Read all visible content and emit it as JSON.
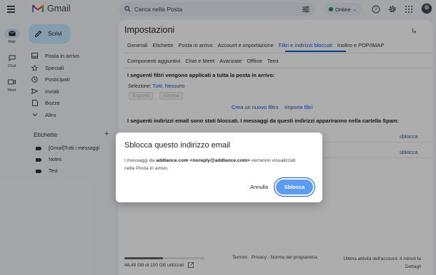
{
  "app": {
    "name": "Gmail"
  },
  "search": {
    "placeholder": "Cerca nella Posta"
  },
  "status": {
    "label": "Online",
    "color": "#1e8e3e"
  },
  "rail": [
    {
      "label": "Mail",
      "icon": "mail-icon",
      "active": true
    },
    {
      "label": "Chat",
      "icon": "chat-icon",
      "active": false
    },
    {
      "label": "Meet",
      "icon": "meet-icon",
      "active": false
    }
  ],
  "sidebar": {
    "compose": "Scrivi",
    "items": [
      {
        "label": "Posta in arrivo",
        "icon": "inbox-icon"
      },
      {
        "label": "Speciali",
        "icon": "star-icon"
      },
      {
        "label": "Posticipati",
        "icon": "clock-icon"
      },
      {
        "label": "Inviati",
        "icon": "send-icon"
      },
      {
        "label": "Bozze",
        "icon": "draft-icon"
      },
      {
        "label": "Altro",
        "icon": "chevron-down-icon"
      }
    ],
    "labels_title": "Etichette",
    "labels": [
      {
        "label": "[Gmail]Tutti i messaggi"
      },
      {
        "label": "Notes"
      },
      {
        "label": "Test"
      }
    ]
  },
  "main": {
    "title": "Impostazioni",
    "input_tools": "Iₐ",
    "tabs_row1": [
      "Generali",
      "Etichette",
      "Posta in arrivo",
      "Account e importazione",
      "Filtri e indirizzi bloccati",
      "Inoltro e POP/IMAP"
    ],
    "tabs_row2": [
      "Componenti aggiuntivi",
      "Chat e Meet",
      "Avanzate",
      "Offline",
      "Temi"
    ],
    "active_tab": "Filtri e indirizzi bloccati",
    "filters_heading": "I seguenti filtri vengono applicati a tutta la posta in arrivo:",
    "select_label": "Selezione:",
    "select_all": "Tutti",
    "select_none": "Nessuno",
    "export_label": "Esporta",
    "delete_label": "Elimina",
    "create_filter": "Crea un nuovo filtro",
    "import_filters": "Importa filtri",
    "blocked_heading": "I seguenti indirizzi email sono stati bloccati. I messaggi da questi indirizzi appariranno nella cartella Spam:",
    "unblock_links": [
      "sblocca",
      "sblocca"
    ],
    "storage_text": "48,48 GB di 100 GB utilizzati",
    "storage_fraction": 0.4848,
    "footer_links": "Termini · Privacy · Norme del programma",
    "last_activity": "Ultima attività dell'account: 4 minuti fa",
    "details": "Dettagli"
  },
  "dialog": {
    "title": "Sblocca questo indirizzo email",
    "body_prefix": "I messaggi da ",
    "body_sender": "addlance.com <noreply@addlance.com>",
    "body_suffix": " verranno visualizzati nella Posta in arrivo.",
    "cancel_label": "Annulla",
    "confirm_label": "Sblocca"
  },
  "colors": {
    "accent": "#0b57d0",
    "compose": "#c2e7ff",
    "confirm_button": "#5b9bf0"
  }
}
